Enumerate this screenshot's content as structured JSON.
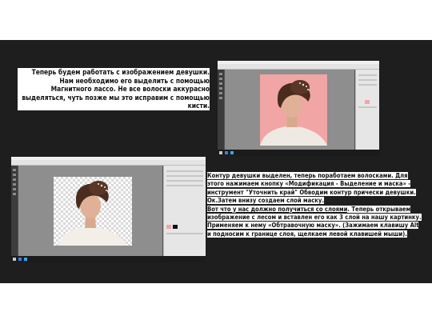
{
  "slide": {
    "caption_top": "Теперь будем работать с изображением девушки. Нам необходимо его выделить с помощью Магнитного лассо. Не все волоски аккурасно выделяться, чуть позже мы это исправим с помощью кисти.",
    "caption_bottom": {
      "part1": "Контур девушки выделен, теперь поработаем волосками. Для этого нажимаем кнопку «Модификация - Выделение и маска» - инструмент \"Уточнить край\" Обводим контур прически девушки. Ок.Затем внизу создаем слой маску.",
      "highlight": "Вот что у нас должно получиться со слоями",
      "part2": ". Теперь открываем изображение с лесом и вставлен его как 3 слой на нашу картинку. Применяем к нему «Обтравочную маску». (Зажимаем клавишу Alt и подносим к границе слоя, щелкаем левой клавишей мыши)."
    }
  },
  "screenshots": {
    "top": {
      "background": "pink",
      "accent": "#f2a5a5"
    },
    "bottom": {
      "background": "transparent"
    }
  },
  "colors": {
    "pink": "#f2a5a5",
    "slide_bg": "#1e1e1e",
    "ps_dark": "#535353",
    "canvas_gray": "#8e8e8e"
  }
}
